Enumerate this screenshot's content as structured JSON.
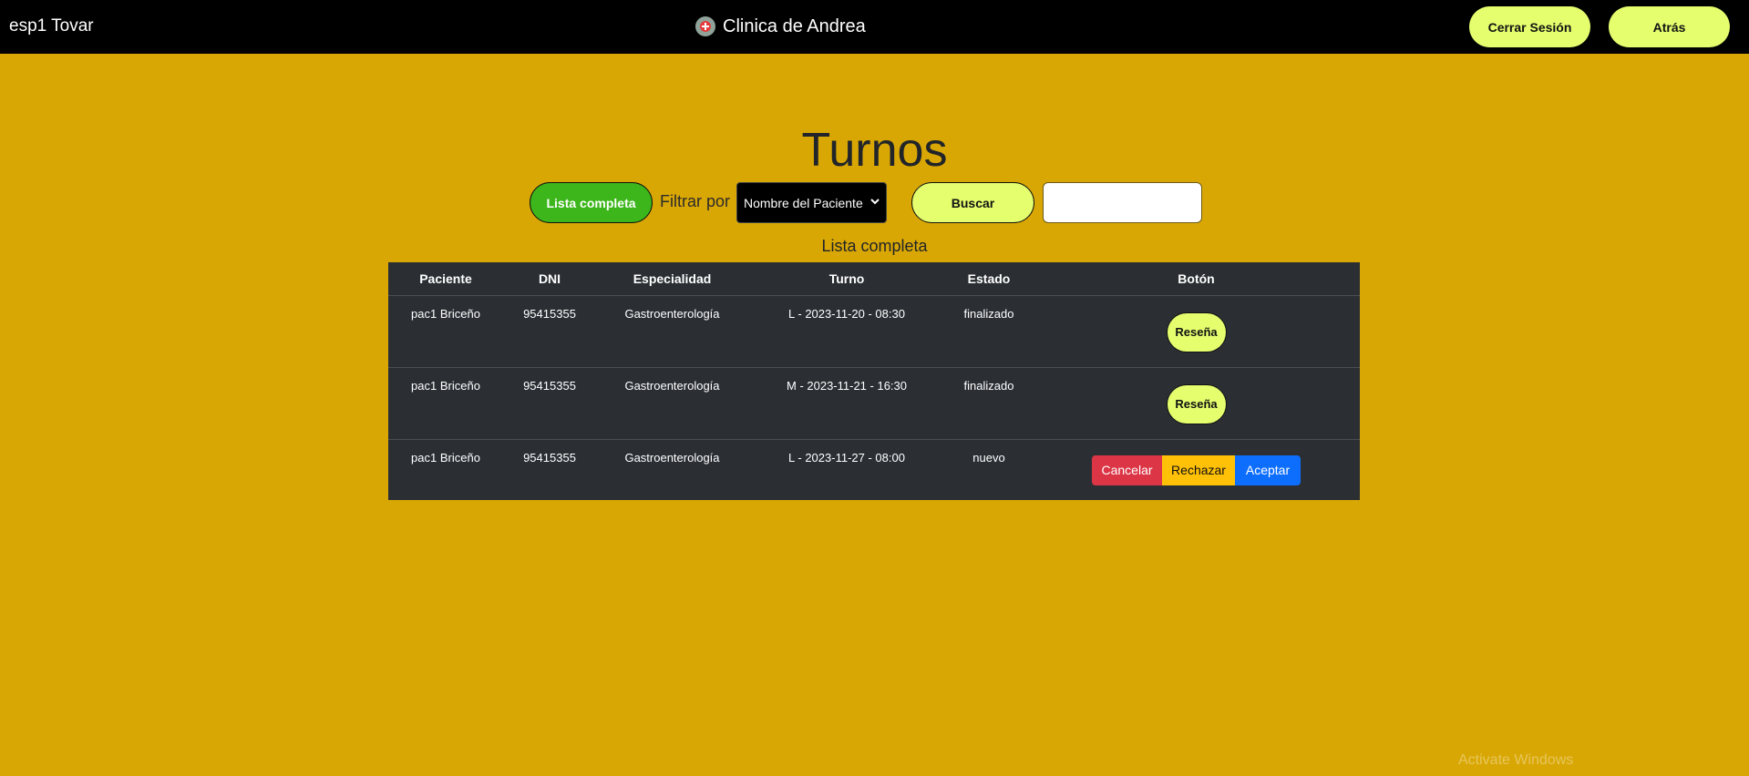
{
  "navbar": {
    "user": "esp1 Tovar",
    "brand": "Clinica de Andrea",
    "logout_label": "Cerrar Sesión",
    "back_label": "Atrás"
  },
  "page": {
    "title": "Turnos",
    "full_list_label": "Lista completa",
    "filter_label": "Filtrar por",
    "filter_selected": "Nombre del Paciente",
    "search_label": "Buscar",
    "search_value": "",
    "subtitle": "Lista completa"
  },
  "table": {
    "headers": [
      "Paciente",
      "DNI",
      "Especialidad",
      "Turno",
      "Estado",
      "Botón"
    ],
    "rows": [
      {
        "paciente": "pac1 Briceño",
        "dni": "95415355",
        "especialidad": "Gastroenterología",
        "turno": "L - 2023-11-20 - 08:30",
        "estado": "finalizado",
        "action": "Reseña"
      },
      {
        "paciente": "pac1 Briceño",
        "dni": "95415355",
        "especialidad": "Gastroenterología",
        "turno": "M - 2023-11-21 - 16:30",
        "estado": "finalizado",
        "action": "Reseña"
      },
      {
        "paciente": "pac1 Briceño",
        "dni": "95415355",
        "especialidad": "Gastroenterología",
        "turno": "L - 2023-11-27 - 08:00",
        "estado": "nuevo",
        "actions": [
          "Cancelar",
          "Rechazar",
          "Aceptar"
        ]
      }
    ]
  },
  "watermark": "Activate Windows",
  "colors": {
    "background": "#d9a704",
    "navbar": "#000000",
    "pill_button": "#e4fe6e",
    "full_list_button": "#3cb61b",
    "table_bg": "#2b2f34",
    "cancel": "#dc3545",
    "reject": "#ffc107",
    "accept": "#0d6efd"
  },
  "icons": {
    "brand": "clinic-logo-icon",
    "select": "chevron-down-icon"
  }
}
